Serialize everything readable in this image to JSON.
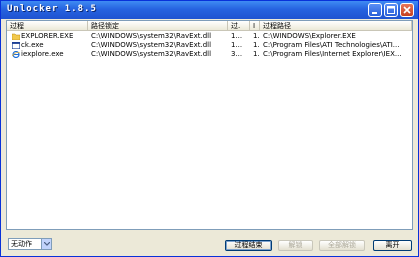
{
  "window": {
    "title": "Unlocker 1.8.5"
  },
  "columns": [
    "过程",
    "路径锁定",
    "过.",
    "I",
    "过程路径"
  ],
  "rows": [
    {
      "process": "EXPLORER.EXE",
      "locked_path": "C:\\WINDOWS\\system32\\RavExt.dll",
      "pid": "1...",
      "handle": "1...",
      "process_path": "C:\\WINDOWS\\Explorer.EXE",
      "icon": "folder-icon"
    },
    {
      "process": "ck.exe",
      "locked_path": "C:\\WINDOWS\\system32\\RavExt.dll",
      "pid": "1...",
      "handle": "1...",
      "process_path": "C:\\Program Files\\ATI Technologies\\ATI...",
      "icon": "application-icon"
    },
    {
      "process": "iexplore.exe",
      "locked_path": "C:\\WINDOWS\\system32\\RavExt.dll",
      "pid": "3...",
      "handle": "1...",
      "process_path": "C:\\Program Files\\Internet Explorer\\IEX...",
      "icon": "ie-icon"
    }
  ],
  "action_select": {
    "value": "无动作"
  },
  "buttons": {
    "kill_process": "过程结束",
    "unlock": "解锁",
    "unlock_all": "全部解锁",
    "exit": "离开"
  },
  "colors": {
    "title_bar": "#2663e0",
    "window_bg": "#ece9d8",
    "list_border": "#7f9db9"
  }
}
